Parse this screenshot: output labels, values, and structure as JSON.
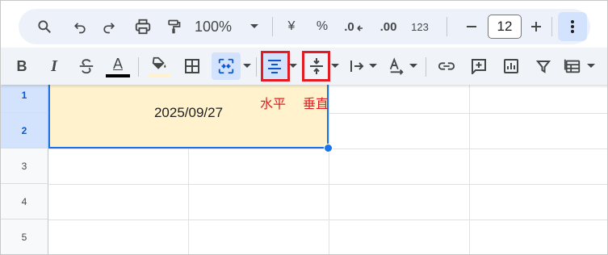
{
  "toolbar_top": {
    "zoom_value": "100%",
    "currency_symbol": "¥",
    "percent_symbol": "%",
    "decrease_decimals": ".0",
    "increase_decimals": ".00",
    "number_format": "123",
    "font_size": "12"
  },
  "toolbar_format": {
    "bold": "B",
    "italic": "I",
    "text_color_letter": "A",
    "text_color": "#000000",
    "fill_color": "#fff2cc",
    "active_buttons": [
      "merge-cells",
      "horizontal-align"
    ]
  },
  "annotations": {
    "horizontal": "水平",
    "vertical": "垂直",
    "highlight_color": "#e31c23"
  },
  "sheet": {
    "row_numbers": [
      "1",
      "2",
      "3",
      "4",
      "5"
    ],
    "selected_rows": [
      "1",
      "2"
    ],
    "merged_cell_value": "2025/09/27",
    "merged_cell_fill": "#fff2cc"
  }
}
